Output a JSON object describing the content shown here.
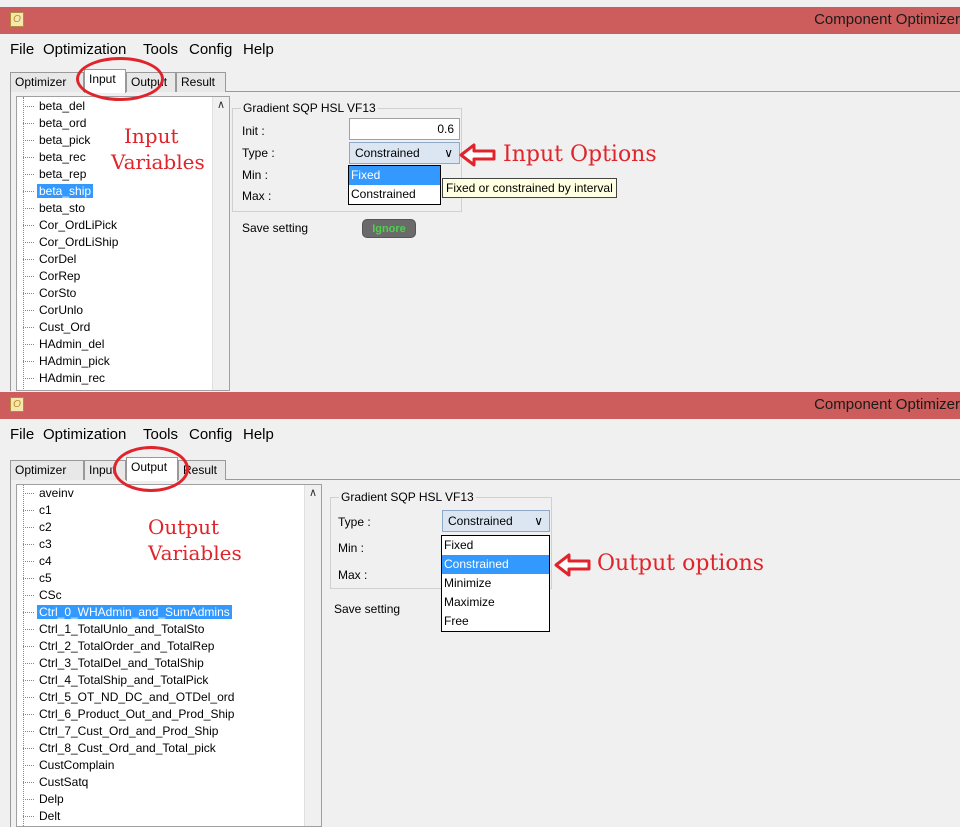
{
  "panel1": {
    "window": {
      "title": "Component Optimizer",
      "icon": "optimizer-app-icon"
    },
    "menu": [
      "File",
      "Optimization",
      "Tools",
      "Config",
      "Help"
    ],
    "tabs": [
      "Optimizer",
      "Input",
      "Output",
      "Result"
    ],
    "active_tab": "Input",
    "tree_items": [
      "beta_del",
      "beta_ord",
      "beta_pick",
      "beta_rec",
      "beta_rep",
      "beta_ship",
      "beta_sto",
      "Cor_OrdLiPick",
      "Cor_OrdLiShip",
      "CorDel",
      "CorRep",
      "CorSto",
      "CorUnlo",
      "Cust_Ord",
      "HAdmin_del",
      "HAdmin_pick",
      "HAdmin_rec"
    ],
    "selected_item": "beta_ship",
    "group_title": "Gradient SQP HSL VF13",
    "labels": {
      "init": "Init :",
      "type": "Type :",
      "min": "Min :",
      "max": "Max :"
    },
    "init_value": "0.6",
    "type_value": "Constrained",
    "dropdown_options": [
      "Fixed",
      "Constrained"
    ],
    "dropdown_selected": "Fixed",
    "tooltip": "Fixed or constrained by interval",
    "save_label": "Save setting",
    "save_button": "Ignore",
    "annotations": {
      "variables_line1": "Input",
      "variables_line2": "Variables",
      "options": "Input Options"
    }
  },
  "panel2": {
    "window": {
      "title": "Component Optimizer",
      "icon": "optimizer-app-icon"
    },
    "menu": [
      "File",
      "Optimization",
      "Tools",
      "Config",
      "Help"
    ],
    "tabs": [
      "Optimizer",
      "Input",
      "Output",
      "Result"
    ],
    "active_tab": "Output",
    "tree_items": [
      "aveinv",
      "c1",
      "c2",
      "c3",
      "c4",
      "c5",
      "CSc",
      "Ctrl_0_WHAdmin_and_SumAdmins",
      "Ctrl_1_TotalUnlo_and_TotalSto",
      "Ctrl_2_TotalOrder_and_TotalRep",
      "Ctrl_3_TotalDel_and_TotalShip",
      "Ctrl_4_TotalShip_and_TotalPick",
      "Ctrl_5_OT_ND_DC_and_OTDel_ord",
      "Ctrl_6_Product_Out_and_Prod_Ship",
      "Ctrl_7_Cust_Ord_and_Prod_Ship",
      "Ctrl_8_Cust_Ord_and_Total_pick",
      "CustComplain",
      "CustSatq",
      "Delp",
      "Delt"
    ],
    "selected_item": "Ctrl_0_WHAdmin_and_SumAdmins",
    "group_title": "Gradient SQP HSL VF13",
    "labels": {
      "type": "Type :",
      "min": "Min :",
      "max": "Max :"
    },
    "type_value": "Constrained",
    "dropdown_options": [
      "Fixed",
      "Constrained",
      "Minimize",
      "Maximize",
      "Free"
    ],
    "dropdown_selected": "Constrained",
    "save_label": "Save setting",
    "annotations": {
      "variables_line1": "Output",
      "variables_line2": "Variables",
      "options": "Output options"
    }
  },
  "colors": {
    "titlebar": "#cd5c5c",
    "selection": "#3399ff",
    "annotation": "#e0242b",
    "ignore_text": "#4cd14c"
  }
}
